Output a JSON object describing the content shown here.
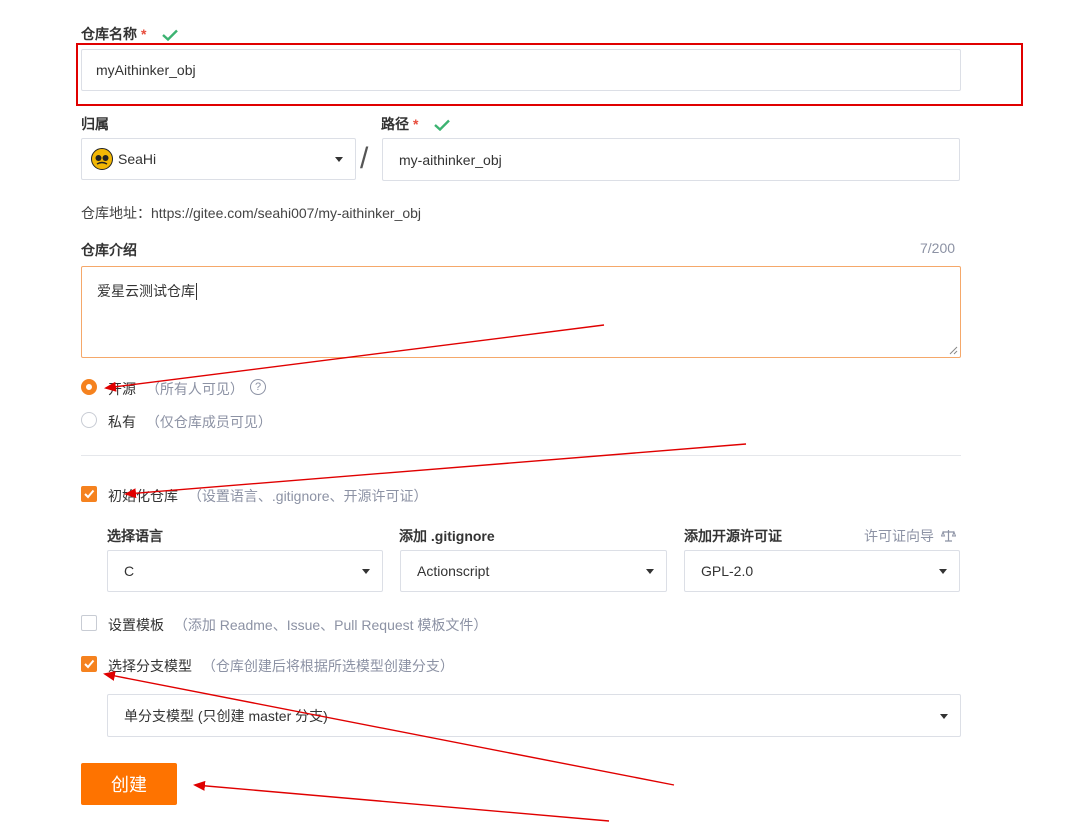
{
  "repo_name": {
    "label": "仓库名称",
    "required_mark": "*",
    "value": "myAithinker_obj"
  },
  "owner": {
    "label": "归属",
    "value": "SeaHi"
  },
  "path": {
    "label": "路径",
    "required_mark": "*",
    "value": "my-aithinker_obj",
    "separator": "/"
  },
  "repo_address": {
    "text": "仓库地址：https://gitee.com/seahi007/my-aithinker_obj"
  },
  "description": {
    "label": "仓库介绍",
    "counter": "7/200",
    "value": "爱星云测试仓库"
  },
  "visibility": {
    "public": {
      "label": "开源",
      "hint": "（所有人可见）",
      "help": "?"
    },
    "private": {
      "label": "私有",
      "hint": "（仅仓库成员可见）"
    }
  },
  "init_repo": {
    "label": "初始化仓库",
    "hint": "（设置语言、.gitignore、开源许可证）"
  },
  "language": {
    "label": "选择语言",
    "value": "C"
  },
  "gitignore": {
    "label": "添加 .gitignore",
    "value": "Actionscript"
  },
  "license": {
    "label": "添加开源许可证",
    "guide": "许可证向导",
    "value": "GPL-2.0"
  },
  "template": {
    "label": "设置模板",
    "hint": "（添加 Readme、Issue、Pull Request 模板文件）"
  },
  "branch_model": {
    "label": "选择分支模型",
    "hint": "（仓库创建后将根据所选模型创建分支）",
    "value": "单分支模型 (只创建 master 分支)"
  },
  "submit": {
    "label": "创建"
  },
  "colors": {
    "accent": "#fe7300",
    "check_green": "#3cb371",
    "annotation_red": "#e00000"
  }
}
